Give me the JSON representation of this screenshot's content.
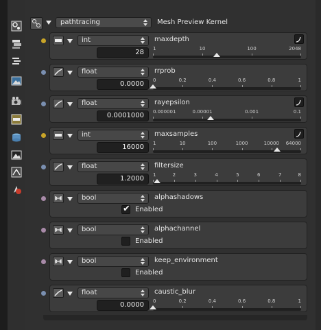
{
  "toolbar": {
    "icons": [
      "node-graph-icon",
      "stack-icon",
      "layers-icon",
      "image-icon",
      "camera-icon",
      "kernel-icon",
      "environment-icon",
      "render-target-icon",
      "imager-icon",
      "material-icon"
    ]
  },
  "header": {
    "select_value": "pathtracing",
    "title": "Mesh Preview Kernel"
  },
  "colors": {
    "int_dot": "#c8a428",
    "float_dot": "#7a8fb0",
    "bool_dot": "#a88aa8"
  },
  "params": [
    {
      "kind": "int",
      "type": "int",
      "name": "maxdepth",
      "value": "28",
      "curve": true,
      "ticks": [
        "1",
        "10",
        "100",
        "2048"
      ],
      "thumb": 0.43
    },
    {
      "kind": "float",
      "type": "float",
      "name": "rrprob",
      "value": "0.0000",
      "curve": false,
      "ticks": [
        "0",
        "0.2",
        "0.4",
        "0.6",
        "0.8",
        "1"
      ],
      "thumb": 0.0
    },
    {
      "kind": "float",
      "type": "float",
      "name": "rayepsilon",
      "value": "0.0001000",
      "curve": true,
      "ticks": [
        "0.000001",
        "0.00001",
        "0.001",
        "0.1"
      ],
      "thumb": 0.39
    },
    {
      "kind": "int",
      "type": "int",
      "name": "maxsamples",
      "value": "16000",
      "curve": true,
      "ticks": [
        "1",
        "10",
        "100",
        "1000",
        "10000",
        "64000"
      ],
      "thumb": 0.84
    },
    {
      "kind": "float",
      "type": "float",
      "name": "filtersize",
      "value": "1.2000",
      "curve": false,
      "ticks": [
        "1",
        "2",
        "3",
        "4",
        "5",
        "6",
        "7",
        "8"
      ],
      "thumb": 0.03
    },
    {
      "kind": "bool",
      "type": "bool",
      "name": "alphashadows",
      "checked": true,
      "label": "Enabled"
    },
    {
      "kind": "bool",
      "type": "bool",
      "name": "alphachannel",
      "checked": false,
      "label": "Enabled"
    },
    {
      "kind": "bool",
      "type": "bool",
      "name": "keep_environment",
      "checked": false,
      "label": "Enabled"
    },
    {
      "kind": "float",
      "type": "float",
      "name": "caustic_blur",
      "value": "0.0000",
      "curve": false,
      "ticks": [
        "0",
        "0.2",
        "0.4",
        "0.6",
        "0.8",
        "1"
      ],
      "thumb": 0.0
    }
  ]
}
